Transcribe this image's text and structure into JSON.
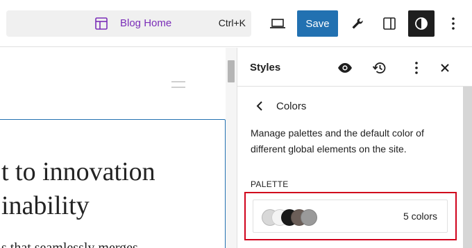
{
  "toolbar": {
    "command_title": "Blog Home",
    "shortcut": "Ctrl+K",
    "save_label": "Save",
    "icons": [
      "template-icon",
      "desktop-preview-icon",
      "wrench-icon",
      "sidebar-panel-icon",
      "styles-contrast-icon",
      "more-vertical-icon"
    ]
  },
  "canvas": {
    "heading_line_1": "t to innovation",
    "heading_line_2": "inability",
    "paragraph": "s that seamlessly merges"
  },
  "styles_panel": {
    "title": "Styles",
    "section_title": "Colors",
    "description": "Manage palettes and the default color of different global elements on the site.",
    "palette_label": "PALETTE",
    "palette_count": "5 colors",
    "swatch_colors": [
      "#d8d8d8",
      "#f4f4f4",
      "#1a1a1a",
      "#6b5e58",
      "#9a9a9a"
    ],
    "accent_color": "#2271b1",
    "highlight_color": "#d0021b"
  }
}
